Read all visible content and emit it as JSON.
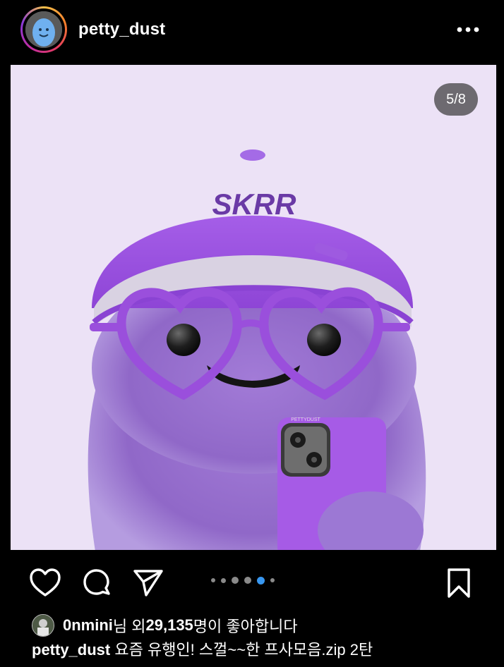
{
  "header": {
    "username": "petty_dust",
    "more_icon": "more-horizontal-icon"
  },
  "post": {
    "slide_counter": "5/8",
    "cap_text": "SKRR",
    "phone_text": "PETTYDUST"
  },
  "actions": {
    "like_icon": "heart-icon",
    "comment_icon": "comment-icon",
    "share_icon": "send-icon",
    "save_icon": "bookmark-icon",
    "carousel": {
      "total_dots": 6,
      "active_index": 4
    }
  },
  "likes": {
    "user": "0nmini",
    "mid": "님 외 ",
    "count": "29,135",
    "tail": "명이 좋아합니다"
  },
  "caption": {
    "user": "petty_dust",
    "text": " 요즘 유행인! 스껄~~한 프사모음.zip 2탄"
  },
  "colors": {
    "post_bg": "#ece2f6",
    "accent_purple": "#9a4fdc",
    "active_dot": "#3897f0"
  }
}
